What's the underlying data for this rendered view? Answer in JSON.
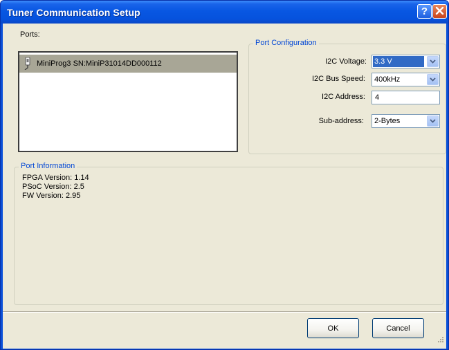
{
  "window": {
    "title": "Tuner Communication Setup",
    "help_glyph": "?",
    "close_glyph": "✕"
  },
  "ports": {
    "label": "Ports:",
    "items": [
      {
        "label": "MiniProg3 SN:MiniP31014DD000112",
        "selected": true
      }
    ]
  },
  "port_configuration": {
    "legend": "Port Configuration",
    "i2c_voltage": {
      "label": "I2C Voltage:",
      "value": "3.3 V"
    },
    "i2c_bus_speed": {
      "label": "I2C Bus Speed:",
      "value": "400kHz"
    },
    "i2c_address": {
      "label": "I2C Address:",
      "value": "4"
    },
    "sub_address": {
      "label": "Sub-address:",
      "value": "2-Bytes"
    }
  },
  "port_information": {
    "legend": "Port Information",
    "lines": [
      "FPGA Version: 1.14",
      "PSoC Version: 2.5",
      "FW Version: 2.95"
    ]
  },
  "buttons": {
    "ok": "OK",
    "cancel": "Cancel"
  },
  "colors": {
    "title_bar": "#0a50d8",
    "dialog_face": "#ece9d8",
    "group_legend": "#0046d5",
    "selection": "#316ac5",
    "list_selected_row": "#a8a696"
  }
}
